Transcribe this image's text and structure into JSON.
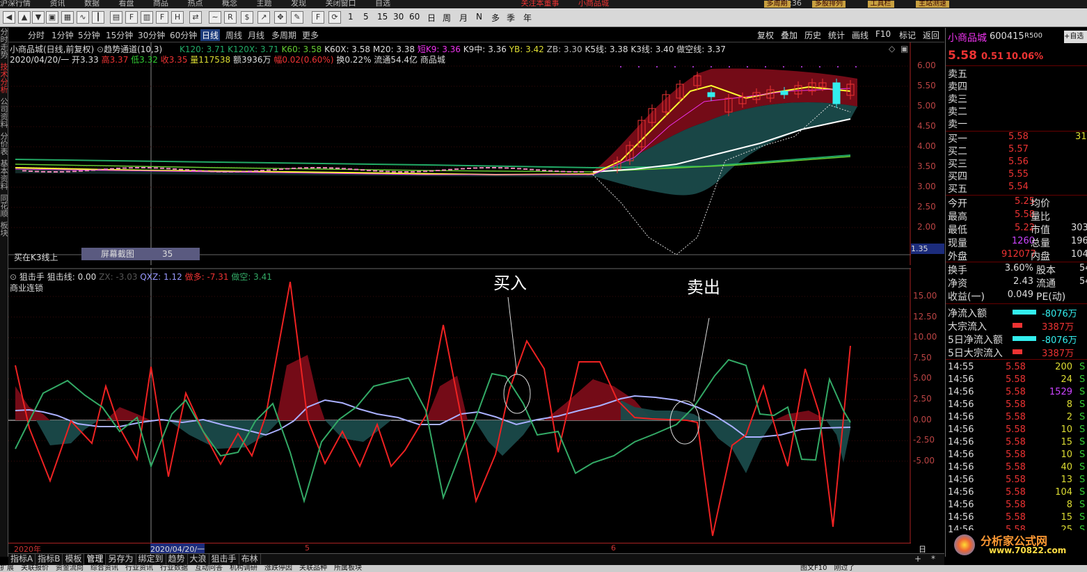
{
  "top_menu": {
    "items": [
      "沪深行情",
      "资讯",
      "数据",
      "看盘",
      "商品",
      "热点",
      "概念",
      "主题",
      "发现",
      "关闭窗口",
      "自选"
    ],
    "alert": "关注本董事",
    "alert2": "小商品城",
    "time": "10:23:36",
    "weekday": "周日",
    "buttons": [
      "多周期",
      "多股排列",
      "工具栏",
      "主站测速"
    ]
  },
  "toolbar": {
    "periods": [
      "1",
      "5",
      "15",
      "30",
      "60"
    ],
    "cycles": [
      "日",
      "周",
      "月",
      "N",
      "多",
      "季",
      "年"
    ]
  },
  "period_bar": {
    "items": [
      "分时",
      "1分钟",
      "5分钟",
      "15分钟",
      "30分钟",
      "60分钟",
      "日线",
      "周线",
      "月线",
      "多周期",
      "更多"
    ],
    "active": "日线",
    "right": [
      "复权",
      "叠加",
      "历史",
      "统计",
      "画线",
      "F10",
      "标记",
      "返回"
    ]
  },
  "left_sidebar": [
    "分时走势",
    "技术分析",
    "公司资料",
    "分价表",
    "基本资料",
    "同花顺",
    "板块"
  ],
  "main_chart": {
    "title": "小商品城(日线,前复权)",
    "indicator": "趋势通道(10,3)",
    "ind_values": [
      {
        "t": "K120: 3.71",
        "c": "#2a6"
      },
      {
        "t": "K120X: 3.71",
        "c": "#2a6"
      },
      {
        "t": "K60: 3.58",
        "c": "#6c3"
      },
      {
        "t": "K60X: 3.58",
        "c": "#ddd"
      },
      {
        "t": "M20: 3.38",
        "c": "#ddd"
      },
      {
        "t": "短K9: 3.36",
        "c": "#e3e"
      },
      {
        "t": "K9中: 3.36",
        "c": "#ddd"
      },
      {
        "t": "YB: 3.42",
        "c": "#dd3"
      },
      {
        "t": "ZB: 3.30",
        "c": "#bbb"
      },
      {
        "t": "K5线: 3.38",
        "c": "#ddd"
      },
      {
        "t": "K3线: 3.40",
        "c": "#ddd"
      },
      {
        "t": "做空线: 3.37",
        "c": "#ddd"
      }
    ],
    "info": {
      "date": "2020/04/20/一",
      "open": "开3.33",
      "high": "高3.37",
      "low": "低3.32",
      "close": "收3.35",
      "vol": "量117538",
      "amount": "额3936万",
      "change": "幅0.02(0.60%)",
      "turnover": "换0.22%",
      "float": "流通54.4亿",
      "board": "商品城"
    },
    "ylabels": [
      "6.00",
      "5.50",
      "5.00",
      "4.50",
      "4.00",
      "3.50",
      "3.00",
      "2.50",
      "2.00"
    ],
    "bottom_text": "买在K3线上",
    "screenshot_tip": "屏幕截图",
    "tip_val": "35",
    "cursor_val": "1.35"
  },
  "sub_chart": {
    "name": "狙击手",
    "sub": "商业连锁",
    "values": [
      {
        "t": "狙击线: 0.00",
        "c": "#ddd"
      },
      {
        "t": "ZX: -3.03",
        "c": "#555"
      },
      {
        "t": "QXZ: 1.12",
        "c": "#99f"
      },
      {
        "t": "做多: -7.31",
        "c": "#e33"
      },
      {
        "t": "做空: 3.41",
        "c": "#3a6"
      }
    ],
    "buy_label": "买入",
    "sell_label": "卖出",
    "ylabels": [
      "15.00",
      "12.50",
      "10.00",
      "7.50",
      "5.00",
      "2.50",
      "0.00",
      "-2.50",
      "-5.00"
    ]
  },
  "time_axis": {
    "labels": [
      "2020年",
      "2020/04/20/一",
      "5",
      "6"
    ],
    "period": "日线"
  },
  "bottom_tabs": [
    "指标A",
    "指标B",
    "模板",
    "管理",
    "另存为",
    "绑定到",
    "趋势",
    "大浪",
    "狙击手",
    "布林"
  ],
  "status_bar": [
    "扩展",
    "关联报价",
    "资金流向",
    "综合资讯",
    "行业资讯",
    "行业数据",
    "互动问答",
    "机构调研",
    "涨跌停因",
    "关联品种",
    "所属板块",
    "图文F10",
    "刚过了"
  ],
  "right_panel": {
    "name": "小商品城",
    "code": "600415",
    "tag": "R500",
    "price": "5.58",
    "change": "0.51",
    "pct": "10.06%",
    "sells": [
      "卖五",
      "卖四",
      "卖三",
      "卖二",
      "卖一"
    ],
    "buys": [
      {
        "l": "买一",
        "p": "5.58",
        "v": "31"
      },
      {
        "l": "买二",
        "p": "5.57",
        "v": ""
      },
      {
        "l": "买三",
        "p": "5.56",
        "v": ""
      },
      {
        "l": "买四",
        "p": "5.55",
        "v": ""
      },
      {
        "l": "买五",
        "p": "5.54",
        "v": ""
      }
    ],
    "stats": [
      {
        "l": "今开",
        "v": "5.25",
        "c": "#e33",
        "l2": "均价",
        "v2": ""
      },
      {
        "l": "最高",
        "v": "5.58",
        "c": "#e33",
        "l2": "量比",
        "v2": ""
      },
      {
        "l": "最低",
        "v": "5.22",
        "c": "#e33",
        "l2": "市值",
        "v2": "303"
      },
      {
        "l": "现量",
        "v": "1260",
        "c": "#c4f",
        "l2": "总量",
        "v2": "196"
      },
      {
        "l": "外盘",
        "v": "912077",
        "c": "#e33",
        "l2": "内盘",
        "v2": "104"
      }
    ],
    "stats2": [
      {
        "l": "换手",
        "v": "3.60%",
        "l2": "股本",
        "v2": "54"
      },
      {
        "l": "净资",
        "v": "2.43",
        "l2": "流通",
        "v2": "54"
      },
      {
        "l": "收益(一)",
        "v": "0.049",
        "l2": "PE(动)",
        "v2": ""
      }
    ],
    "flows": [
      {
        "l": "净流入额",
        "v": "-8076万",
        "c": "#3ee"
      },
      {
        "l": "大宗流入",
        "v": "3387万",
        "c": "#e33"
      },
      {
        "l": "5日净流入额",
        "v": "-8076万",
        "c": "#3ee"
      },
      {
        "l": "5日大宗流入",
        "v": "3387万",
        "c": "#e33"
      }
    ],
    "ticks": [
      {
        "t": "14:55",
        "p": "5.58",
        "v": "200",
        "s": "S"
      },
      {
        "t": "14:56",
        "p": "5.58",
        "v": "24",
        "s": "S"
      },
      {
        "t": "14:56",
        "p": "5.58",
        "v": "1529",
        "s": "S"
      },
      {
        "t": "14:56",
        "p": "5.58",
        "v": "8",
        "s": "S"
      },
      {
        "t": "14:56",
        "p": "5.58",
        "v": "2",
        "s": "S"
      },
      {
        "t": "14:56",
        "p": "5.58",
        "v": "10",
        "s": "S"
      },
      {
        "t": "14:56",
        "p": "5.58",
        "v": "15",
        "s": "S"
      },
      {
        "t": "14:56",
        "p": "5.58",
        "v": "10",
        "s": "S"
      },
      {
        "t": "14:56",
        "p": "5.58",
        "v": "40",
        "s": "S"
      },
      {
        "t": "14:56",
        "p": "5.58",
        "v": "13",
        "s": "S"
      },
      {
        "t": "14:56",
        "p": "5.58",
        "v": "104",
        "s": "S"
      },
      {
        "t": "14:56",
        "p": "5.58",
        "v": "8",
        "s": "S"
      },
      {
        "t": "14:56",
        "p": "5.58",
        "v": "15",
        "s": "S"
      },
      {
        "t": "14:56",
        "p": "5.58",
        "v": "25",
        "s": "S"
      }
    ],
    "watermark": "分析家公式网",
    "watermark_url": "www.70822.com"
  }
}
